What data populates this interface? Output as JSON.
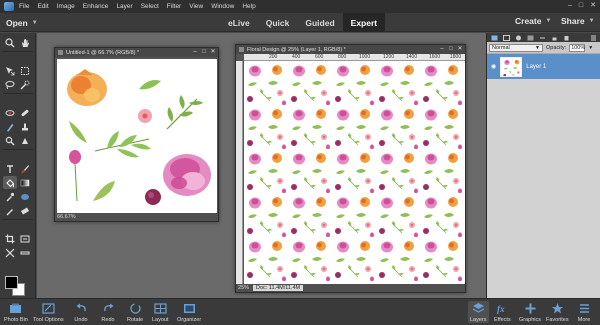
{
  "menu": [
    "File",
    "Edit",
    "Image",
    "Enhance",
    "Layer",
    "Select",
    "Filter",
    "View",
    "Window",
    "Help"
  ],
  "topbar": {
    "open": "Open",
    "modes": [
      "eLive",
      "Quick",
      "Guided",
      "Expert"
    ],
    "active_mode": "Expert",
    "create": "Create",
    "share": "Share"
  },
  "doc1": {
    "title": "Untitled-1 @ 66.7% (RGB/8) *",
    "zoom": "66.67%"
  },
  "doc2": {
    "title": "Floral Design @ 25% (Layer 1, RGB/8) *",
    "zoom": "25%",
    "doc_size": "Doc: 11.4M/11.4M",
    "ruler_labels": [
      "200",
      "400",
      "600",
      "800",
      "1000",
      "1200",
      "1400",
      "1600",
      "1800"
    ]
  },
  "layers_panel": {
    "blend_mode": "Normal",
    "opacity_label": "Opacity:",
    "opacity_value": "100%",
    "layer_name": "Layer 1"
  },
  "bottom_bar": {
    "left": [
      "Photo Bin",
      "Tool Options",
      "Undo",
      "Redo",
      "Rotate",
      "Layout",
      "Organizer"
    ],
    "right": [
      "Layers",
      "Effects",
      "Graphics",
      "Favorites",
      "More"
    ]
  },
  "colors": {
    "accent_blue": "#5b8fc9",
    "foreground": "#000000",
    "background": "#ffffff"
  }
}
